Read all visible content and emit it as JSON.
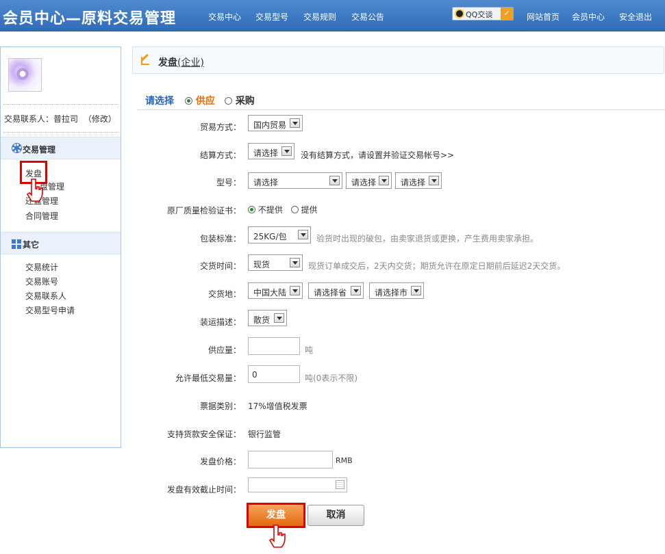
{
  "header": {
    "title": "会员中心—原料交易管理",
    "nav": [
      "交易中心",
      "交易型号",
      "交易规则",
      "交易公告"
    ],
    "qq_label": "QQ交谈",
    "links": [
      "网站首页",
      "会员中心",
      "安全退出"
    ]
  },
  "sidebar": {
    "contact_text": "交易联系人：普拉司",
    "modify_label": "（修改）",
    "trade_section": {
      "title": "交易管理",
      "items": [
        "发盘",
        "盘管理",
        "还盘管理",
        "合同管理"
      ]
    },
    "other_section": {
      "title": "其它",
      "items": [
        "交易统计",
        "交易账号",
        "交易联系人",
        "交易型号申请"
      ]
    }
  },
  "page": {
    "title": "发盘",
    "subtitle": "(企业)",
    "choose_label": "请选择",
    "options": [
      "供应",
      "采购"
    ],
    "selected_option": "供应"
  },
  "form": {
    "trade_mode": {
      "label": "贸易方式：",
      "value": "国内贸易"
    },
    "settlement": {
      "label": "结算方式：",
      "value": "请选择",
      "hint": "没有结算方式，请设置并验证交易帐号>>"
    },
    "model": {
      "label": "型号：",
      "values": [
        "请选择",
        "请选择",
        "请选择"
      ]
    },
    "cert": {
      "label": "原厂质量检验证书：",
      "options": [
        "不提供",
        "提供"
      ],
      "selected": "不提供"
    },
    "packaging": {
      "label": "包装标准：",
      "value": "25KG/包",
      "hint": "验货时出现的破包，由卖家退货或更换，产生费用卖家承担。"
    },
    "delivery_time": {
      "label": "交货时间：",
      "value": "现货",
      "hint": "现货订单成交后，2天内交货；期货允许在原定日期前后延迟2天交货。"
    },
    "delivery_place": {
      "label": "交货地：",
      "values": [
        "中国大陆",
        "请选择省",
        "请选择市"
      ]
    },
    "shipping": {
      "label": "装运描述：",
      "value": "散货"
    },
    "supply_qty": {
      "label": "供应量：",
      "value": "",
      "unit": "吨"
    },
    "min_qty": {
      "label": "允许最低交易量：",
      "value": "0",
      "unit": "吨(0表示不限)"
    },
    "invoice": {
      "label": "票据类别：",
      "value": "17%增值税发票"
    },
    "guarantee": {
      "label": "支持货款安全保证：",
      "value": "银行监管"
    },
    "price": {
      "label": "发盘价格：",
      "value": "",
      "unit": "RMB"
    },
    "deadline": {
      "label": "发盘有效截止时间：",
      "value": ""
    }
  },
  "buttons": {
    "submit": "发盘",
    "cancel": "取消"
  },
  "colors": {
    "header_bg": "#3a78c4",
    "highlight_red": "#e00000",
    "accent_orange": "#ee6a00",
    "link_blue": "#2a63b8"
  }
}
